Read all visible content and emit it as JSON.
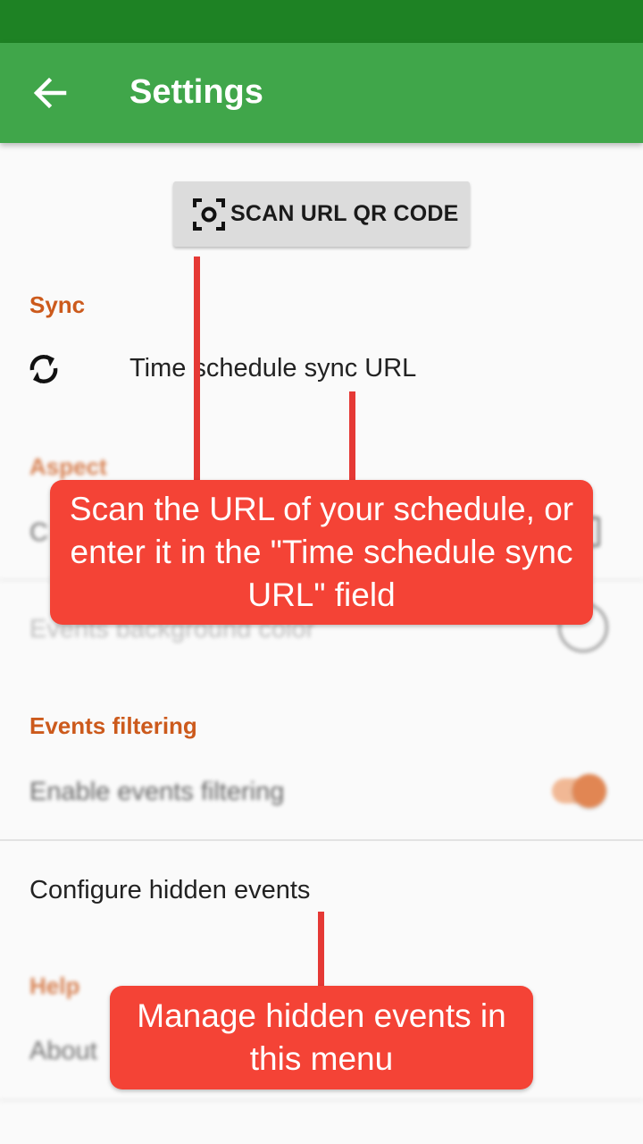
{
  "app_bar": {
    "title": "Settings",
    "back_icon": "arrow-left-icon"
  },
  "scan_button": {
    "icon": "qr-scan-icon",
    "label": "SCAN URL QR CODE"
  },
  "sections": {
    "sync": {
      "header": "Sync",
      "url_item": {
        "icon": "sync-icon",
        "label": "Time schedule sync URL"
      }
    },
    "aspect": {
      "header": "Aspect",
      "first_item_partial": "C",
      "background_color_item": "Events background color"
    },
    "events_filtering": {
      "header": "Events filtering",
      "enable_item": "Enable events filtering",
      "enable_on": true,
      "hidden_events_item": "Configure hidden events"
    },
    "help": {
      "header": "Help",
      "about_item": "About"
    }
  },
  "callouts": {
    "url": "Scan the URL of your schedule, or enter it in the \"Time schedule sync URL\" field",
    "hidden_events": "Manage hidden events in this menu"
  },
  "colors": {
    "status_bar": "#1e8224",
    "app_bar": "#40a64a",
    "accent": "#cc5a1c",
    "callout": "#f44336"
  }
}
